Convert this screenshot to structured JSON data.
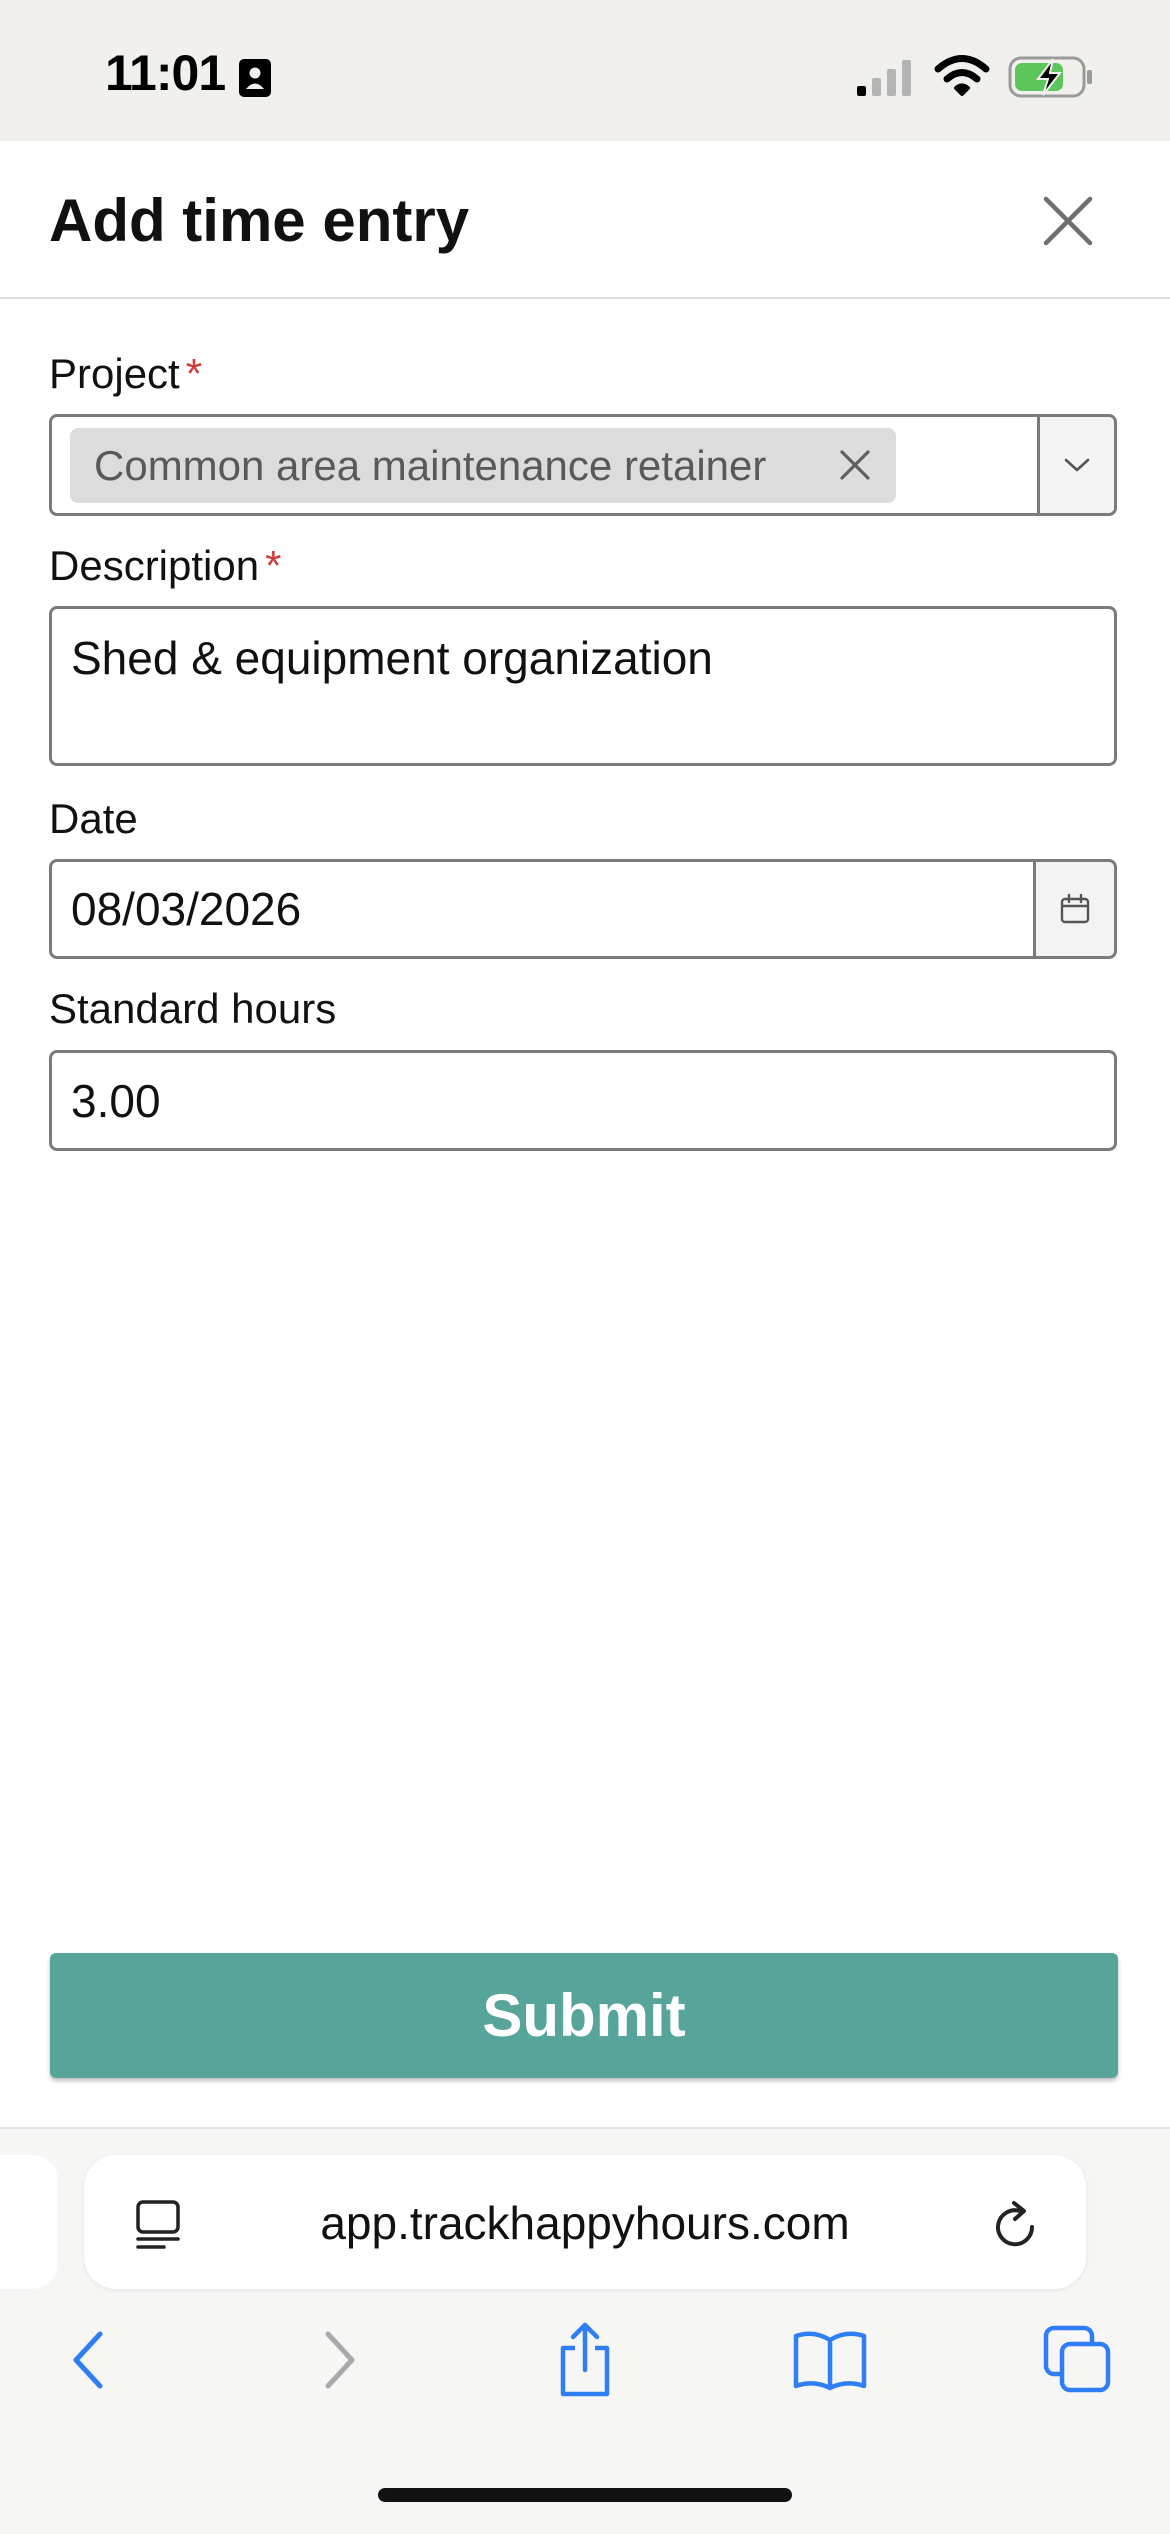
{
  "status_bar": {
    "time": "11:01"
  },
  "header": {
    "title": "Add time entry"
  },
  "form": {
    "project": {
      "label": "Project",
      "required_mark": "*",
      "selected_chip": "Common area maintenance retainer"
    },
    "description": {
      "label": "Description",
      "required_mark": "*",
      "value": "Shed & equipment organization"
    },
    "date": {
      "label": "Date",
      "value": "08/03/2026"
    },
    "standard_hours": {
      "label": "Standard hours",
      "value": "3.00"
    },
    "submit_label": "Submit"
  },
  "browser": {
    "url": "app.trackhappyhours.com"
  },
  "colors": {
    "accent": "#57a59a",
    "required": "#d33a3a",
    "browser_blue": "#2f7ef6"
  }
}
